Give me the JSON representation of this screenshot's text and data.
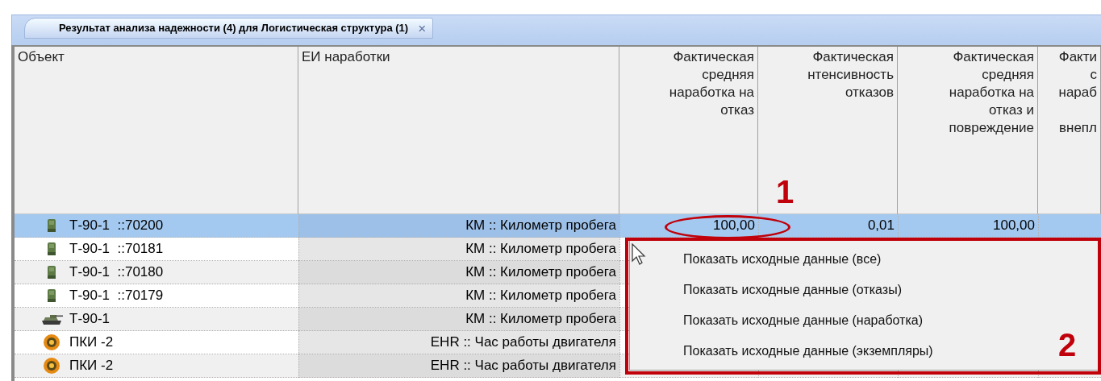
{
  "tab": {
    "title": "Результат анализа надежности (4) для Логистическая структура (1)",
    "close": "×"
  },
  "table": {
    "columns": [
      "Объект",
      "ЕИ наработки",
      "Фактическая\nсредняя\nнаработка на\nотказ",
      "Фактическая\nнтенсивность\nотказов",
      "Фактическая\nсредняя\nнаработка на\nотказ и\nповреждение",
      "Факти\nс\nнараб\n\nвнепл"
    ],
    "rows": [
      {
        "kind": "instance",
        "object": "Т-90-1  ::70200",
        "unit": "КМ :: Километр пробега",
        "values": [
          "100,00",
          "0,01",
          "100,00"
        ],
        "selected": true
      },
      {
        "kind": "instance",
        "object": "Т-90-1  ::70181",
        "unit": "КМ :: Километр пробега",
        "values": [],
        "selected": false
      },
      {
        "kind": "instance",
        "object": "Т-90-1  ::70180",
        "unit": "КМ :: Километр пробега",
        "values": [],
        "selected": false
      },
      {
        "kind": "instance",
        "object": "Т-90-1  ::70179",
        "unit": "КМ :: Километр пробега",
        "values": [],
        "selected": false
      },
      {
        "kind": "vehicle",
        "object": "Т-90-1",
        "unit": "КМ :: Километр пробега",
        "values": [],
        "selected": false
      },
      {
        "kind": "part",
        "object": "ПКИ -2",
        "unit": "EHR :: Час работы двигателя",
        "values": [],
        "selected": false
      },
      {
        "kind": "part",
        "object": "ПКИ -2",
        "unit": "EHR :: Час работы двигателя",
        "values": [],
        "selected": false
      }
    ]
  },
  "context_menu": {
    "items": [
      "Показать исходные данные (все)",
      "Показать исходные данные (отказы)",
      "Показать исходные данные (наработка)",
      "Показать исходные данные (экземпляры)"
    ]
  },
  "annotations": [
    "1",
    "2"
  ]
}
